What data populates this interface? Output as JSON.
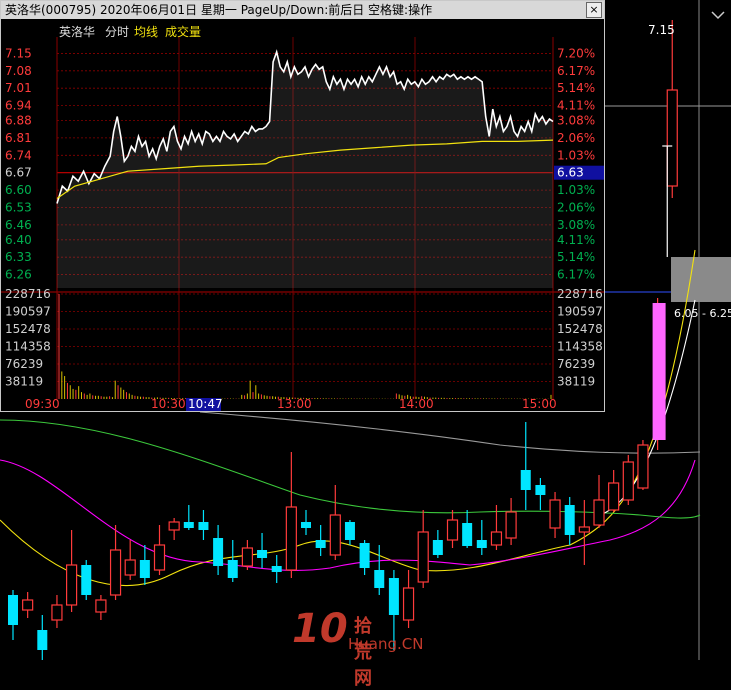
{
  "window": {
    "title": "英洛华(000795)  2020年06月01日  星期一  PageUp/Down:前后日  空格键:操作",
    "close_label": "×"
  },
  "header": {
    "stock_name": "英洛华",
    "tab_timeshare": "分时",
    "tab_avg": "均线",
    "tab_volume": "成交量"
  },
  "colors": {
    "up": "#ff3b3b",
    "down": "#00b050",
    "neutral": "#d0d0d0",
    "price_line": "#ffffff",
    "avg_line": "#f2e20f",
    "grid": "#8b0000",
    "candle_up": "#ff3b3b",
    "candle_down": "#00e5ff",
    "limit_bar": "#ff66ff",
    "ma_yellow": "#f2e20f",
    "ma_magenta": "#ff00ff",
    "ma_green": "#3cc83c",
    "ma_white": "#ffffff"
  },
  "chart_data": {
    "type": "line",
    "price_axis_left": [
      "7.15",
      "7.08",
      "7.01",
      "6.94",
      "6.88",
      "6.81",
      "6.74",
      "6.67",
      "6.60",
      "6.53",
      "6.46",
      "6.40",
      "6.33",
      "6.26"
    ],
    "pct_axis_right": [
      "7.20%",
      "6.17%",
      "5.14%",
      "4.11%",
      "3.08%",
      "2.06%",
      "1.03%",
      "6.63",
      "1.03%",
      "2.06%",
      "3.08%",
      "4.11%",
      "5.14%",
      "6.17%"
    ],
    "prev_close": 6.63,
    "volume_axis": [
      "228716",
      "190597",
      "152478",
      "114358",
      "76239",
      "38119"
    ],
    "time_labels": [
      "09:30",
      "10:30",
      "10:47",
      "13:00",
      "14:00",
      "15:00"
    ],
    "cursor_time": "10:47",
    "price_series": [
      [
        0,
        6.55
      ],
      [
        3,
        6.62
      ],
      [
        6,
        6.6
      ],
      [
        9,
        6.66
      ],
      [
        12,
        6.64
      ],
      [
        15,
        6.68
      ],
      [
        18,
        6.63
      ],
      [
        21,
        6.67
      ],
      [
        24,
        6.65
      ],
      [
        27,
        6.7
      ],
      [
        30,
        6.74
      ],
      [
        32,
        6.84
      ],
      [
        34,
        6.9
      ],
      [
        36,
        6.82
      ],
      [
        38,
        6.72
      ],
      [
        40,
        6.74
      ],
      [
        42,
        6.78
      ],
      [
        44,
        6.76
      ],
      [
        46,
        6.82
      ],
      [
        48,
        6.78
      ],
      [
        50,
        6.8
      ],
      [
        52,
        6.74
      ],
      [
        54,
        6.77
      ],
      [
        56,
        6.73
      ],
      [
        58,
        6.78
      ],
      [
        60,
        6.81
      ],
      [
        62,
        6.76
      ],
      [
        64,
        6.84
      ],
      [
        66,
        6.86
      ],
      [
        68,
        6.8
      ],
      [
        70,
        6.77
      ],
      [
        72,
        6.82
      ],
      [
        74,
        6.79
      ],
      [
        76,
        6.84
      ],
      [
        78,
        6.8
      ],
      [
        80,
        6.83
      ],
      [
        82,
        6.79
      ],
      [
        84,
        6.84
      ],
      [
        86,
        6.83
      ],
      [
        88,
        6.8
      ],
      [
        90,
        6.82
      ],
      [
        92,
        6.8
      ],
      [
        94,
        6.84
      ],
      [
        96,
        6.82
      ],
      [
        98,
        6.81
      ],
      [
        100,
        6.83
      ],
      [
        102,
        6.8
      ],
      [
        104,
        6.82
      ],
      [
        106,
        6.84
      ],
      [
        108,
        6.83
      ],
      [
        110,
        6.86
      ],
      [
        112,
        6.84
      ],
      [
        114,
        6.85
      ],
      [
        116,
        6.85
      ],
      [
        118,
        6.86
      ],
      [
        120,
        6.88
      ],
      [
        122,
        7.12
      ],
      [
        124,
        7.16
      ],
      [
        126,
        7.1
      ],
      [
        128,
        7.08
      ],
      [
        130,
        7.12
      ],
      [
        132,
        7.06
      ],
      [
        134,
        7.1
      ],
      [
        136,
        7.07
      ],
      [
        138,
        7.08
      ],
      [
        140,
        7.1
      ],
      [
        142,
        7.06
      ],
      [
        144,
        7.09
      ],
      [
        146,
        7.11
      ],
      [
        148,
        7.09
      ],
      [
        150,
        7.1
      ],
      [
        152,
        7.04
      ],
      [
        154,
        7.01
      ],
      [
        156,
        7.06
      ],
      [
        158,
        7.03
      ],
      [
        160,
        7.05
      ],
      [
        162,
        7.01
      ],
      [
        164,
        7.05
      ],
      [
        166,
        7.03
      ],
      [
        168,
        7.05
      ],
      [
        170,
        7.02
      ],
      [
        172,
        7.06
      ],
      [
        174,
        7.03
      ],
      [
        176,
        7.06
      ],
      [
        178,
        7.04
      ],
      [
        180,
        7.07
      ],
      [
        182,
        7.1
      ],
      [
        184,
        7.07
      ],
      [
        186,
        7.1
      ],
      [
        188,
        7.06
      ],
      [
        190,
        7.08
      ],
      [
        192,
        7.03
      ],
      [
        194,
        7.04
      ],
      [
        196,
        7.01
      ],
      [
        198,
        7.05
      ],
      [
        200,
        7.03
      ],
      [
        202,
        7.04
      ],
      [
        204,
        7.02
      ],
      [
        206,
        7.05
      ],
      [
        208,
        7.03
      ],
      [
        210,
        7.04
      ],
      [
        212,
        7.06
      ],
      [
        214,
        7.04
      ],
      [
        216,
        7.06
      ],
      [
        218,
        7.05
      ],
      [
        220,
        7.07
      ],
      [
        222,
        7.06
      ],
      [
        224,
        7.07
      ],
      [
        226,
        7.05
      ],
      [
        228,
        7.06
      ],
      [
        230,
        7.05
      ],
      [
        232,
        7.06
      ],
      [
        234,
        7.05
      ],
      [
        236,
        7.06
      ],
      [
        238,
        7.05
      ],
      [
        240,
        7.04
      ],
      [
        242,
        6.9
      ],
      [
        244,
        6.82
      ],
      [
        246,
        6.93
      ],
      [
        248,
        6.86
      ],
      [
        250,
        6.9
      ],
      [
        252,
        6.84
      ],
      [
        254,
        6.86
      ],
      [
        256,
        6.9
      ],
      [
        258,
        6.84
      ],
      [
        260,
        6.82
      ],
      [
        262,
        6.86
      ],
      [
        264,
        6.84
      ],
      [
        266,
        6.88
      ],
      [
        268,
        6.84
      ],
      [
        270,
        6.91
      ],
      [
        272,
        6.88
      ],
      [
        274,
        6.9
      ],
      [
        276,
        6.87
      ],
      [
        278,
        6.89
      ],
      [
        280,
        6.88
      ]
    ],
    "avg_series": [
      [
        0,
        6.57
      ],
      [
        10,
        6.62
      ],
      [
        20,
        6.64
      ],
      [
        30,
        6.66
      ],
      [
        40,
        6.68
      ],
      [
        60,
        6.69
      ],
      [
        80,
        6.7
      ],
      [
        100,
        6.705
      ],
      [
        118,
        6.71
      ],
      [
        125,
        6.735
      ],
      [
        140,
        6.75
      ],
      [
        160,
        6.765
      ],
      [
        180,
        6.775
      ],
      [
        200,
        6.785
      ],
      [
        220,
        6.79
      ],
      [
        240,
        6.8
      ],
      [
        260,
        6.8
      ],
      [
        280,
        6.805
      ]
    ],
    "volume": [
      228716,
      60000,
      50000,
      35000,
      30000,
      22000,
      20000,
      28000,
      15000,
      12000,
      9000,
      12000,
      8000,
      7000,
      7000,
      6000,
      5000,
      5000,
      6000,
      4000,
      40000,
      30000,
      25000,
      20000,
      15000,
      12000,
      9000,
      7000,
      6000,
      5000,
      5000,
      4000,
      4000,
      3000,
      3000,
      3500,
      3000,
      2500,
      2500,
      2500,
      2000,
      2000,
      2000,
      1800,
      2000,
      1800,
      1500,
      1500,
      1800,
      1500,
      1200,
      1200,
      1000,
      1200,
      1000,
      1000,
      1000,
      900,
      900,
      900,
      1200,
      1000,
      900,
      900,
      800,
      9000,
      8000,
      12000,
      40000,
      15000,
      30000,
      12000,
      10000,
      8000,
      7000,
      6000,
      6000,
      5000,
      5000,
      4000,
      4000,
      3500,
      3500,
      3000,
      3000,
      2500,
      2500,
      2500,
      2000,
      2000,
      2000,
      1800,
      1800,
      1600,
      1500,
      1500,
      1400,
      1300,
      1200,
      1200,
      1200,
      1100,
      1100,
      1000,
      1000,
      1000,
      900,
      900,
      900,
      900,
      800,
      800,
      800,
      700,
      700,
      700,
      700,
      600,
      600,
      600,
      12000,
      10000,
      8000,
      7000,
      9000,
      6000,
      5000,
      5000,
      4000,
      6000,
      5000,
      4000,
      3000,
      3000,
      3000,
      2500,
      2500,
      2500,
      2000,
      2000,
      2000,
      2000,
      1800,
      1800,
      1600,
      1500,
      1500,
      1500,
      1500,
      1400,
      1400,
      1300,
      1200,
      1200,
      1200,
      1100,
      1100,
      1000,
      1000,
      1000,
      900,
      900,
      900,
      800,
      800,
      800,
      800,
      700,
      700,
      700,
      700,
      700,
      600,
      600,
      600,
      9000
    ]
  },
  "kline": {
    "high_label": "7.15",
    "range_label": "6.05 - 6.25",
    "candles": [
      {
        "o": 595,
        "c": 625,
        "h": 590,
        "l": 640,
        "up": false
      },
      {
        "o": 600,
        "c": 610,
        "h": 592,
        "l": 618,
        "up": true
      },
      {
        "o": 630,
        "c": 650,
        "h": 615,
        "l": 660,
        "up": false
      },
      {
        "o": 605,
        "c": 620,
        "h": 595,
        "l": 628,
        "up": true
      },
      {
        "o": 565,
        "c": 605,
        "h": 530,
        "l": 612,
        "up": true
      },
      {
        "o": 565,
        "c": 595,
        "h": 560,
        "l": 600,
        "up": false
      },
      {
        "o": 600,
        "c": 612,
        "h": 595,
        "l": 620,
        "up": true
      },
      {
        "o": 550,
        "c": 595,
        "h": 525,
        "l": 600,
        "up": true
      },
      {
        "o": 560,
        "c": 575,
        "h": 540,
        "l": 580,
        "up": true
      },
      {
        "o": 560,
        "c": 578,
        "h": 545,
        "l": 585,
        "up": false
      },
      {
        "o": 545,
        "c": 570,
        "h": 525,
        "l": 575,
        "up": true
      },
      {
        "o": 522,
        "c": 530,
        "h": 518,
        "l": 540,
        "up": true
      },
      {
        "o": 522,
        "c": 528,
        "h": 505,
        "l": 530,
        "up": false
      },
      {
        "o": 522,
        "c": 530,
        "h": 510,
        "l": 540,
        "up": false
      },
      {
        "o": 538,
        "c": 566,
        "h": 525,
        "l": 575,
        "up": false
      },
      {
        "o": 560,
        "c": 578,
        "h": 540,
        "l": 582,
        "up": false
      },
      {
        "o": 548,
        "c": 566,
        "h": 540,
        "l": 570,
        "up": true
      },
      {
        "o": 550,
        "c": 558,
        "h": 533,
        "l": 568,
        "up": false
      },
      {
        "o": 566,
        "c": 572,
        "h": 555,
        "l": 583,
        "up": false
      },
      {
        "o": 507,
        "c": 570,
        "h": 452,
        "l": 578,
        "up": true
      },
      {
        "o": 522,
        "c": 528,
        "h": 510,
        "l": 535,
        "up": false
      },
      {
        "o": 540,
        "c": 548,
        "h": 525,
        "l": 556,
        "up": false
      },
      {
        "o": 515,
        "c": 555,
        "h": 485,
        "l": 560,
        "up": true
      },
      {
        "o": 522,
        "c": 540,
        "h": 520,
        "l": 545,
        "up": false
      },
      {
        "o": 543,
        "c": 568,
        "h": 540,
        "l": 575,
        "up": false
      },
      {
        "o": 570,
        "c": 588,
        "h": 545,
        "l": 595,
        "up": false
      },
      {
        "o": 578,
        "c": 615,
        "h": 570,
        "l": 650,
        "up": false
      },
      {
        "o": 588,
        "c": 620,
        "h": 570,
        "l": 628,
        "up": true
      },
      {
        "o": 532,
        "c": 582,
        "h": 510,
        "l": 588,
        "up": true
      },
      {
        "o": 540,
        "c": 555,
        "h": 530,
        "l": 558,
        "up": false
      },
      {
        "o": 520,
        "c": 540,
        "h": 510,
        "l": 548,
        "up": true
      },
      {
        "o": 523,
        "c": 546,
        "h": 510,
        "l": 548,
        "up": false
      },
      {
        "o": 540,
        "c": 548,
        "h": 520,
        "l": 555,
        "up": false
      },
      {
        "o": 532,
        "c": 545,
        "h": 505,
        "l": 550,
        "up": true
      },
      {
        "o": 512,
        "c": 538,
        "h": 498,
        "l": 545,
        "up": true
      },
      {
        "o": 470,
        "c": 490,
        "h": 422,
        "l": 510,
        "up": false
      },
      {
        "o": 485,
        "c": 495,
        "h": 478,
        "l": 510,
        "up": false
      },
      {
        "o": 500,
        "c": 528,
        "h": 492,
        "l": 538,
        "up": true
      },
      {
        "o": 505,
        "c": 535,
        "h": 497,
        "l": 545,
        "up": false
      },
      {
        "o": 527,
        "c": 532,
        "h": 500,
        "l": 565,
        "up": true
      },
      {
        "o": 500,
        "c": 525,
        "h": 475,
        "l": 528,
        "up": true
      },
      {
        "o": 483,
        "c": 510,
        "h": 470,
        "l": 512,
        "up": true
      },
      {
        "o": 462,
        "c": 500,
        "h": 455,
        "l": 505,
        "up": true
      },
      {
        "o": 445,
        "c": 488,
        "h": 440,
        "l": 490,
        "up": true
      },
      {
        "o": 303,
        "c": 440,
        "h": 298,
        "l": 450,
        "up": true
      },
      {
        "o": 90,
        "c": 186,
        "h": 20,
        "l": 198,
        "up": true
      }
    ]
  },
  "watermark": {
    "logo_text": "10",
    "site_cn": "拾荒网",
    "site_en": "Huang.CN"
  }
}
